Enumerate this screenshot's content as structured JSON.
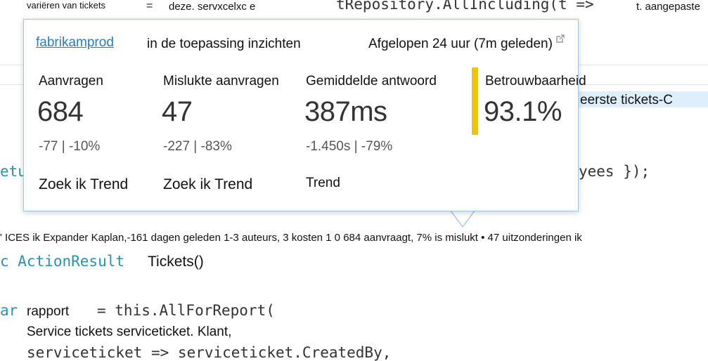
{
  "background_code": {
    "top_left_small": "variëren van tickets",
    "top_eq": "=",
    "top_mid_small": "deze. servxcelxc e",
    "top_code": "tRepository.AllIncluding(t =>",
    "top_right_small": "t. aangepaste",
    "right_highlight": "eerste tickets-C",
    "left_partial_1": "etu",
    "right_code_1": "yees });",
    "codelens_line": "' ICES ik Expander Kaplan,-161 dagen geleden 1-3 auteurs, 3 kosten 1 0 684 aanvraagt, 7% is mislukt • 47 uitzonderingen ik",
    "line2_prefix": "c ActionResult",
    "line2_sans": "Tickets()",
    "line3_prefix": "ar",
    "line3_sans": "rapport",
    "line3_code": "= this.AllForReport(",
    "line4_sans": "Service tickets serviceticket. Klant,",
    "line5_code": "serviceticket => serviceticket.CreatedBy,"
  },
  "popup": {
    "app_link": "fabrikamprod",
    "subtitle": "in de toepassing inzichten",
    "time_range": "Afgelopen 24 uur (7m geleden)",
    "external_icon": "external-link-icon",
    "metrics": [
      {
        "label": "Aanvragen",
        "value": "684",
        "delta": "-77  |  -10%",
        "link": "Zoek ik Trend"
      },
      {
        "label": "Mislukte aanvragen",
        "value": "47",
        "delta": "-227  |  -83%",
        "link": "Zoek ik Trend"
      },
      {
        "label": "Gemiddelde antwoord",
        "value": "387ms",
        "delta": "-1.450s  |  -79%",
        "link": "Trend"
      },
      {
        "label": "Betrouwbaarheid",
        "value": "93.1%"
      }
    ],
    "colors": {
      "border": "#9cc7e6",
      "accent_bar": "#f5c400",
      "link": "#2b7bbd"
    }
  }
}
